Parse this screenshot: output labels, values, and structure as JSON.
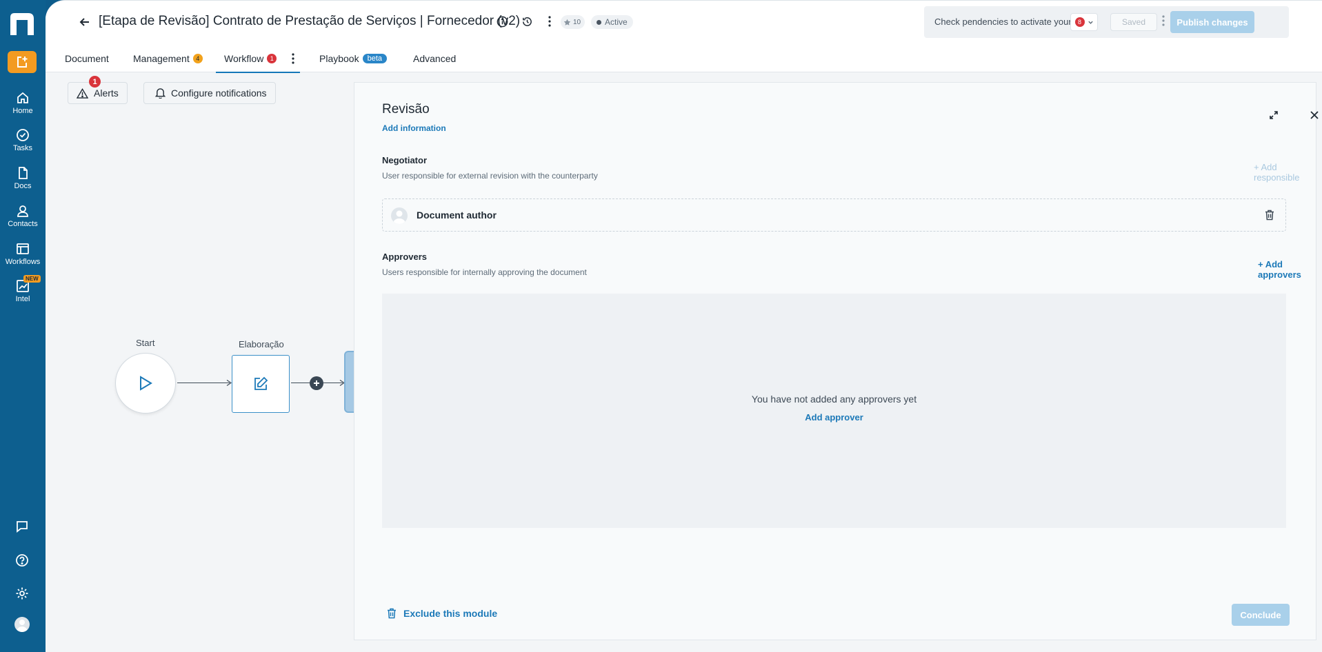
{
  "sidebar": {
    "items": [
      {
        "label": "Home",
        "icon": "home-icon"
      },
      {
        "label": "Tasks",
        "icon": "check-circle-icon"
      },
      {
        "label": "Docs",
        "icon": "document-icon"
      },
      {
        "label": "Contacts",
        "icon": "person-icon"
      },
      {
        "label": "Workflows",
        "icon": "workflow-icon"
      },
      {
        "label": "Intel",
        "icon": "chart-icon"
      }
    ],
    "new_badge": "NEW"
  },
  "header": {
    "title": "[Etapa de Revisão] Contrato de Prestação de Serviços | Fornecedor (v2)",
    "stars": "10",
    "status": "Active"
  },
  "publish": {
    "pendencies_text": "Check pendencies to activate your model",
    "pendencies_count": "8",
    "saved_label": "Saved",
    "publish_label": "Publish changes"
  },
  "tabs": [
    {
      "label": "Document"
    },
    {
      "label": "Management",
      "count": "4"
    },
    {
      "label": "Workflow",
      "count": "1"
    },
    {
      "label": "Playbook",
      "badge": "beta"
    },
    {
      "label": "Advanced"
    }
  ],
  "canvas": {
    "alerts_label": "Alerts",
    "alerts_count": "1",
    "notifications_label": "Configure notifications",
    "nodes": {
      "start": "Start",
      "elaboracao": "Elaboração"
    }
  },
  "panel": {
    "title": "Revisão",
    "add_information": "Add information",
    "negotiator": {
      "title": "Negotiator",
      "description": "User responsible for external revision with the counterparty",
      "add_label": "+ Add responsible",
      "assignee": "Document author"
    },
    "approvers": {
      "title": "Approvers",
      "description": "Users responsible for internally approving the document",
      "add_label": "+ Add approvers",
      "empty_text": "You have not added any approvers yet",
      "empty_link": "Add approver"
    },
    "exclude_label": "Exclude this module",
    "conclude_label": "Conclude"
  },
  "colors": {
    "sidebar": "#0d5f8f",
    "accent": "#1c79b8",
    "orange": "#f39b21",
    "alert_red": "#d9343b"
  }
}
